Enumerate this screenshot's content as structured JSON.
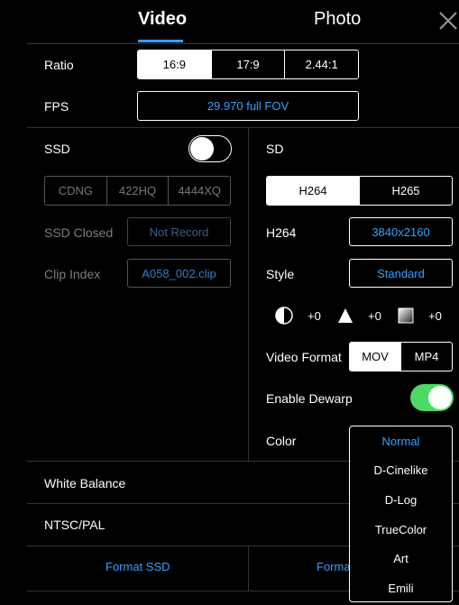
{
  "tabs": {
    "video": "Video",
    "photo": "Photo"
  },
  "close_icon": "close-icon",
  "ratio": {
    "label": "Ratio",
    "options": [
      "16:9",
      "17:9",
      "2.44:1"
    ],
    "selected": "16:9"
  },
  "fps": {
    "label": "FPS",
    "value": "29.970 full FOV"
  },
  "ssd": {
    "label": "SSD",
    "enabled": false,
    "codecs": [
      "CDNG",
      "422HQ",
      "4444XQ"
    ],
    "closed_label": "SSD Closed",
    "closed_value": "Not Record",
    "clip_label": "Clip Index",
    "clip_value": "A058_002.clip"
  },
  "sd": {
    "label": "SD",
    "codecs": [
      "H264",
      "H265"
    ],
    "selected_codec": "H264",
    "res_label": "H264",
    "res_value": "3840x2160",
    "style_label": "Style",
    "style_value": "Standard",
    "adjustments": [
      {
        "icon": "contrast-icon",
        "value": "+0"
      },
      {
        "icon": "sharpness-icon",
        "value": "+0"
      },
      {
        "icon": "saturation-icon",
        "value": "+0"
      }
    ],
    "format_label": "Video Format",
    "formats": [
      "MOV",
      "MP4"
    ],
    "selected_format": "MOV",
    "dewarp_label": "Enable Dewarp",
    "dewarp_enabled": true,
    "color_label": "Color"
  },
  "color_menu": {
    "options": [
      "Normal",
      "D-Cinelike",
      "D-Log",
      "TrueColor",
      "Art",
      "Emili"
    ],
    "selected": "Normal"
  },
  "white_balance": {
    "label": "White Balance"
  },
  "ntsc_pal": {
    "label": "NTSC/PAL"
  },
  "format_ssd": "Format SSD",
  "format_sd": "Forma",
  "colors": {
    "accent": "#33a0ff",
    "toggle_on": "#4cd964",
    "divider": "#333333"
  }
}
